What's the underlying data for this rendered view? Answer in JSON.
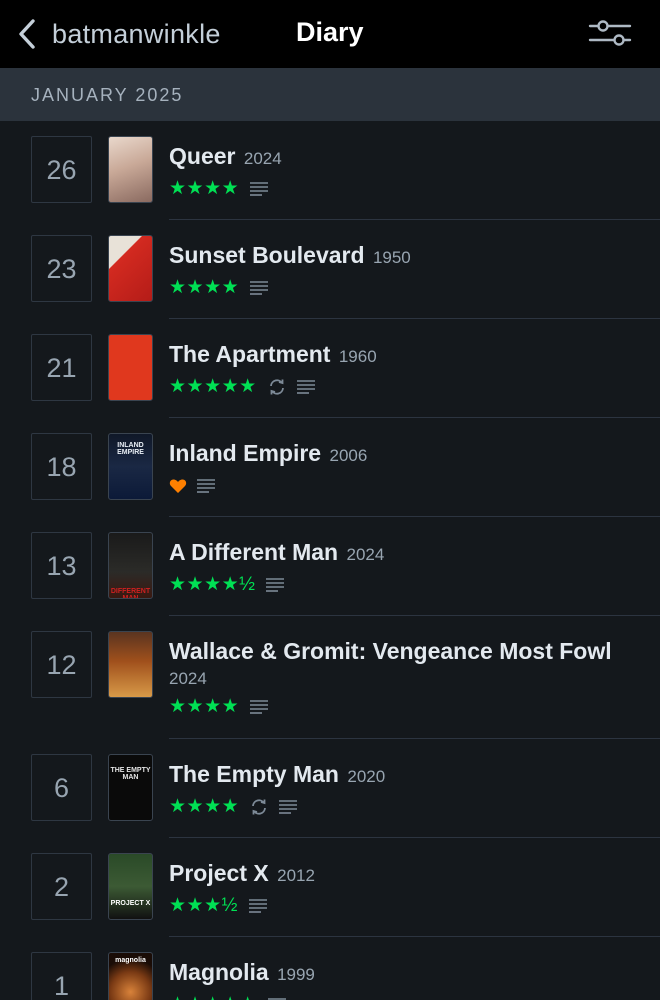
{
  "header": {
    "back_label": "batmanwinkle",
    "title": "Diary"
  },
  "month_label": "JANUARY 2025",
  "accent_colors": {
    "stars": "#00e054",
    "heart": "#ff8000"
  },
  "entries": [
    {
      "day": "26",
      "title": "Queer",
      "year": "2024",
      "stars": "★★★★",
      "liked": false,
      "rewatch": false,
      "review": true
    },
    {
      "day": "23",
      "title": "Sunset Boulevard",
      "year": "1950",
      "stars": "★★★★",
      "liked": false,
      "rewatch": false,
      "review": true
    },
    {
      "day": "21",
      "title": "The Apartment",
      "year": "1960",
      "stars": "★★★★★",
      "liked": false,
      "rewatch": true,
      "review": true
    },
    {
      "day": "18",
      "title": "Inland Empire",
      "year": "2006",
      "stars": "",
      "liked": true,
      "rewatch": false,
      "review": true,
      "poster_text": "INLAND EMPIRE"
    },
    {
      "day": "13",
      "title": "A Different Man",
      "year": "2024",
      "stars": "★★★★½",
      "liked": false,
      "rewatch": false,
      "review": true,
      "poster_text": "DIFFERENT MAN"
    },
    {
      "day": "12",
      "title": "Wallace & Gromit: Vengeance Most Fowl",
      "year": "2024",
      "stars": "★★★★",
      "liked": false,
      "rewatch": false,
      "review": true
    },
    {
      "day": "6",
      "title": "The Empty Man",
      "year": "2020",
      "stars": "★★★★",
      "liked": false,
      "rewatch": true,
      "review": true,
      "poster_text": "THE EMPTY MAN"
    },
    {
      "day": "2",
      "title": "Project X",
      "year": "2012",
      "stars": "★★★½",
      "liked": false,
      "rewatch": false,
      "review": true,
      "poster_text": "PROJECT X"
    },
    {
      "day": "1",
      "title": "Magnolia",
      "year": "1999",
      "stars": "★★★★★",
      "liked": false,
      "rewatch": false,
      "review": true,
      "poster_text": "magnolia"
    }
  ]
}
